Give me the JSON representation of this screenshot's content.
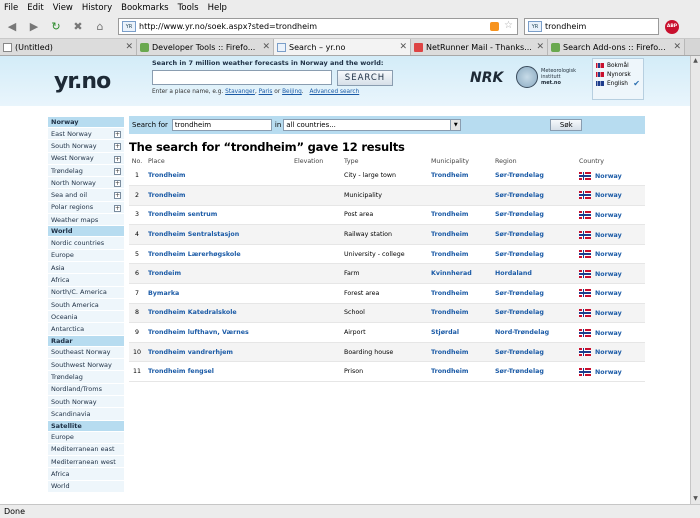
{
  "menu": [
    "File",
    "Edit",
    "View",
    "History",
    "Bookmarks",
    "Tools",
    "Help"
  ],
  "nav": {
    "url": "http://www.yr.no/soek.aspx?sted=trondheim",
    "search_value": "trondheim",
    "abp_label": "ABP"
  },
  "tabs": [
    {
      "label": "(Untitled)",
      "active": false
    },
    {
      "label": "Developer Tools :: Firefo...",
      "active": false
    },
    {
      "label": "Search – yr.no",
      "active": true
    },
    {
      "label": "NetRunner Mail - Thanks...",
      "active": false
    },
    {
      "label": "Search Add-ons :: Firefo...",
      "active": false
    }
  ],
  "banner": {
    "logo": "yr.no",
    "search_title": "Search in 7 million weather forecasts in Norway and the world:",
    "search_button": "SEARCH",
    "hint_prefix": "Enter a place name, e.g.",
    "hint_links": [
      "Stavanger",
      "Paris",
      "Beijing"
    ],
    "hint_sep1": ",",
    "hint_sep2": "or",
    "hint_end": ".",
    "advanced": "Advanced search",
    "nrk": "NRK",
    "met_lines": [
      "Meteorologisk",
      "institutt",
      "met.no"
    ],
    "languages": [
      "Bokmål",
      "Nynorsk",
      "English"
    ]
  },
  "sidebar": [
    {
      "type": "head",
      "label": "Norway"
    },
    {
      "type": "item",
      "label": "East Norway",
      "expand": true
    },
    {
      "type": "item",
      "label": "South Norway",
      "expand": true
    },
    {
      "type": "item",
      "label": "West Norway",
      "expand": true
    },
    {
      "type": "item",
      "label": "Trøndelag",
      "expand": true
    },
    {
      "type": "item",
      "label": "North Norway",
      "expand": true
    },
    {
      "type": "item",
      "label": "Sea and oil",
      "expand": true
    },
    {
      "type": "item",
      "label": "Polar regions",
      "expand": true
    },
    {
      "type": "item",
      "label": "Weather maps",
      "expand": false
    },
    {
      "type": "head",
      "label": "World"
    },
    {
      "type": "item",
      "label": "Nordic countries",
      "expand": false
    },
    {
      "type": "item",
      "label": "Europe",
      "expand": false
    },
    {
      "type": "item",
      "label": "Asia",
      "expand": false
    },
    {
      "type": "item",
      "label": "Africa",
      "expand": false
    },
    {
      "type": "item",
      "label": "North/C. America",
      "expand": false
    },
    {
      "type": "item",
      "label": "South America",
      "expand": false
    },
    {
      "type": "item",
      "label": "Oceania",
      "expand": false
    },
    {
      "type": "item",
      "label": "Antarctica",
      "expand": false
    },
    {
      "type": "head",
      "label": "Radar"
    },
    {
      "type": "item",
      "label": "Southeast Norway",
      "expand": false
    },
    {
      "type": "item",
      "label": "Southwest Norway",
      "expand": false
    },
    {
      "type": "item",
      "label": "Trøndelag",
      "expand": false
    },
    {
      "type": "item",
      "label": "Nordland/Troms",
      "expand": false
    },
    {
      "type": "item",
      "label": "South Norway",
      "expand": false
    },
    {
      "type": "item",
      "label": "Scandinavia",
      "expand": false
    },
    {
      "type": "head",
      "label": "Satellite"
    },
    {
      "type": "item",
      "label": "Europe",
      "expand": false
    },
    {
      "type": "item",
      "label": "Mediterranean east",
      "expand": false
    },
    {
      "type": "item",
      "label": "Mediterranean west",
      "expand": false
    },
    {
      "type": "item",
      "label": "Africa",
      "expand": false
    },
    {
      "type": "item",
      "label": "World",
      "expand": false
    }
  ],
  "search": {
    "label": "Search for",
    "value": "trondheim",
    "in_label": "in",
    "country": "all countries...",
    "button": "Søk"
  },
  "result_title": "The search for “trondheim” gave 12 results",
  "columns": [
    "No.",
    "Place",
    "Elevation",
    "Type",
    "Municipality",
    "Region",
    "Country"
  ],
  "results": [
    {
      "no": "1",
      "place": "Trondheim",
      "elevation": "",
      "type": "City - large town",
      "municipality": "Trondheim",
      "region": "Sør-Trøndelag",
      "country": "Norway"
    },
    {
      "no": "2",
      "place": "Trondheim",
      "elevation": "",
      "type": "Municipality",
      "municipality": "",
      "region": "Sør-Trøndelag",
      "country": "Norway"
    },
    {
      "no": "3",
      "place": "Trondheim sentrum",
      "elevation": "",
      "type": "Post area",
      "municipality": "Trondheim",
      "region": "Sør-Trøndelag",
      "country": "Norway"
    },
    {
      "no": "4",
      "place": "Trondheim Sentralstasjon",
      "elevation": "",
      "type": "Railway station",
      "municipality": "Trondheim",
      "region": "Sør-Trøndelag",
      "country": "Norway"
    },
    {
      "no": "5",
      "place": "Trondheim Lærerhøgskole",
      "elevation": "",
      "type": "University - college",
      "municipality": "Trondheim",
      "region": "Sør-Trøndelag",
      "country": "Norway"
    },
    {
      "no": "6",
      "place": "Trondeim",
      "elevation": "",
      "type": "Farm",
      "municipality": "Kvinnherad",
      "region": "Hordaland",
      "country": "Norway"
    },
    {
      "no": "7",
      "place": "Bymarka",
      "elevation": "",
      "type": "Forest area",
      "municipality": "Trondheim",
      "region": "Sør-Trøndelag",
      "country": "Norway"
    },
    {
      "no": "8",
      "place": "Trondheim Katedralskole",
      "elevation": "",
      "type": "School",
      "municipality": "Trondheim",
      "region": "Sør-Trøndelag",
      "country": "Norway"
    },
    {
      "no": "9",
      "place": "Trondheim lufthavn, Værnes",
      "elevation": "",
      "type": "Airport",
      "municipality": "Stjørdal",
      "region": "Nord-Trøndelag",
      "country": "Norway"
    },
    {
      "no": "10",
      "place": "Trondheim vandrerhjem",
      "elevation": "",
      "type": "Boarding house",
      "municipality": "Trondheim",
      "region": "Sør-Trøndelag",
      "country": "Norway"
    },
    {
      "no": "11",
      "place": "Trondheim fengsel",
      "elevation": "",
      "type": "Prison",
      "municipality": "Trondheim",
      "region": "Sør-Trøndelag",
      "country": "Norway"
    }
  ],
  "status": "Done",
  "colors": {
    "accent": "#b7dcf0",
    "link": "#1a5aa6",
    "banner": "#d3ecf8"
  }
}
